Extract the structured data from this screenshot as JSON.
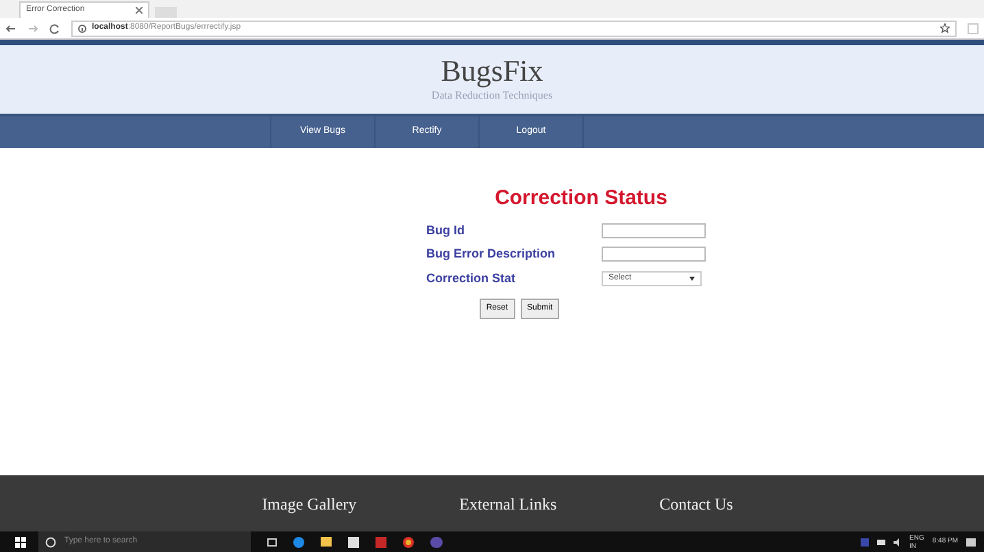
{
  "browser": {
    "tab_title": "Error Correction",
    "url_host": "localhost",
    "url_path": ":8080/ReportBugs/errrectify.jsp"
  },
  "header": {
    "title": "BugsFix",
    "subtitle": "Data Reduction Techniques"
  },
  "nav": [
    {
      "label": "View Bugs"
    },
    {
      "label": "Rectify"
    },
    {
      "label": "Logout"
    }
  ],
  "form": {
    "title": "Correction Status",
    "fields": [
      {
        "label": "Bug Id",
        "kind": "text"
      },
      {
        "label": "Bug Error Description",
        "kind": "text"
      },
      {
        "label": "Correction Stat",
        "kind": "select",
        "value": "Select"
      }
    ],
    "buttons": [
      "Reset",
      "Submit"
    ]
  },
  "footer": [
    "Image Gallery",
    "External  Links",
    "Contact Us"
  ],
  "taskbar": {
    "search_placeholder": "Type here to search",
    "lang": "ENG",
    "region": "IN",
    "time": "8:48 PM"
  }
}
